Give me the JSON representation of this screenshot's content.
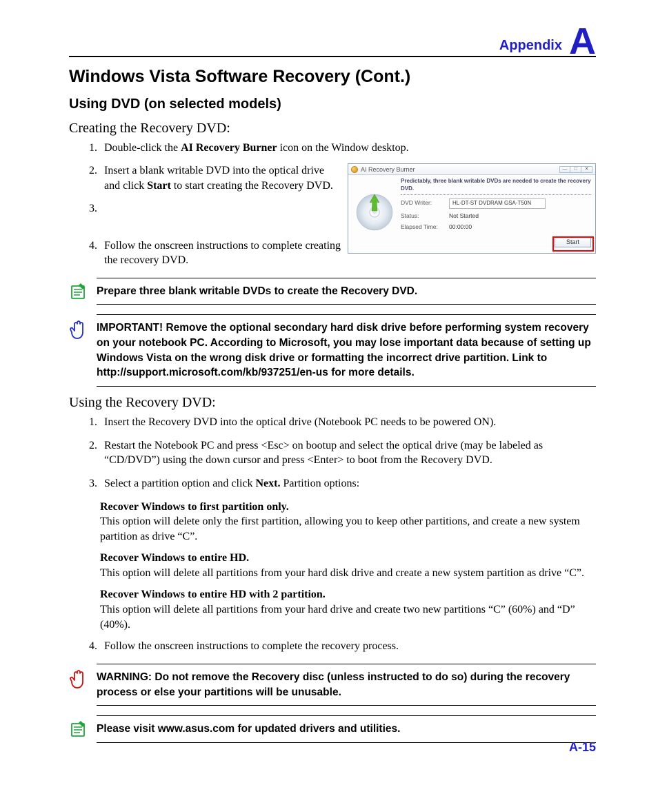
{
  "header": {
    "appendix_label": "Appendix",
    "appendix_letter": "A"
  },
  "h1": "Windows Vista Software Recovery (Cont.)",
  "h2": "Using DVD (on selected models)",
  "h3a": "Creating the Recovery DVD:",
  "step1_a": "Double-click the ",
  "step1_bold": "AI Recovery Burner",
  "step1_b": " icon on the Window desktop.",
  "step2_a": "Insert a blank writable DVD into the optical drive and click ",
  "step2_bold": "Start",
  "step2_b": " to start creating the Recovery DVD.",
  "step3": "Follow the onscreen instructions to complete creating the recovery DVD.",
  "callout_note1": "Prepare three blank writable DVDs to create the Recovery DVD.",
  "callout_important": "IMPORTANT! Remove the optional secondary hard disk drive before performing system recovery on your notebook PC. According to Microsoft, you may lose important data because of setting up Windows Vista on the wrong disk drive or formatting the incorrect drive partition. Link to http://support.microsoft.com/kb/937251/en-us for more details.",
  "h3b": "Using the Recovery DVD:",
  "use1": "Insert the Recovery DVD into the optical drive (Notebook PC needs to be powered ON).",
  "use2": "Restart the Notebook PC and press <Esc> on bootup and select the optical drive (may be labeled as “CD/DVD”) using the down cursor and press <Enter> to boot from the Recovery DVD.",
  "use3_a": "Select a partition option and click ",
  "use3_bold": "Next.",
  "use3_b": " Partition options:",
  "opt1_t": "Recover Windows to first partition only.",
  "opt1_d": "This option will delete only the first partition, allowing you to keep other partitions, and create a new system partition as drive “C”.",
  "opt2_t": "Recover Windows to entire HD.",
  "opt2_d": "This option will delete all partitions from your hard disk drive and create a new system partition as drive “C”.",
  "opt3_t": "Recover Windows to entire HD with 2 partition.",
  "opt3_d": "This option will delete all partitions from your hard drive and create two new partitions “C” (60%) and “D” (40%).",
  "use4": "Follow the onscreen instructions to complete the recovery process.",
  "callout_warning": "WARNING: Do not remove the Recovery disc (unless instructed to do so) during the recovery process or else your partitions will be unusable.",
  "callout_note2": "Please visit www.asus.com for updated drivers and utilities.",
  "page_num": "A-15",
  "app": {
    "title": "AI Recovery Burner",
    "header": "Predictably, three blank writable DVDs are needed to create the recovery DVD.",
    "writer_lbl": "DVD Writer:",
    "writer_val": "HL-DT-ST DVDRAM GSA-T50N",
    "status_lbl": "Status:",
    "status_val": "Not Started",
    "elapsed_lbl": "Elapsed Time:",
    "elapsed_val": "00:00:00",
    "start_btn": "Start"
  }
}
